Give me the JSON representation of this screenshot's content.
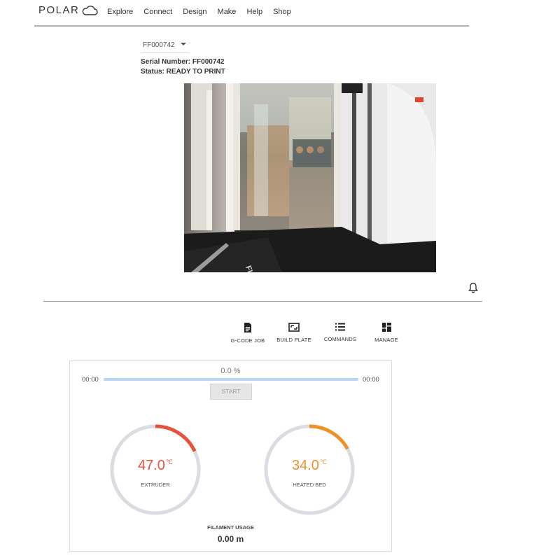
{
  "header": {
    "logo_text": "POLAR",
    "nav": [
      "Explore",
      "Connect",
      "Design",
      "Make",
      "Help",
      "Shop"
    ]
  },
  "printer": {
    "selected": "FF000742",
    "serial": "Serial Number: FF000742",
    "status": "Status: READY TO PRINT"
  },
  "camera": {
    "alt": "printer camera feed"
  },
  "toolbar": [
    {
      "label": "G-CODE JOB",
      "icon": "document-icon"
    },
    {
      "label": "BUILD PLATE",
      "icon": "build-plate-icon"
    },
    {
      "label": "COMMANDS",
      "icon": "list-icon"
    },
    {
      "label": "MANAGE",
      "icon": "dashboard-icon"
    }
  ],
  "job": {
    "progress_text": "0.0 %",
    "progress": 0.0,
    "elapsed": "00:00",
    "remaining": "00:00",
    "start_label": "START"
  },
  "gauges": {
    "extruder": {
      "value": "47.0",
      "unit": "℃",
      "label": "EXTRUDER",
      "fraction": 0.18,
      "color": "#e8513b"
    },
    "bed": {
      "value": "34.0",
      "unit": "℃",
      "label": "HEATED BED",
      "fraction": 0.17,
      "color": "#f0902a"
    }
  },
  "filament": {
    "title": "FILAMENT USAGE",
    "value": "0.00 m"
  },
  "colors": {
    "gauge_track": "#d9dde2",
    "accent_blue": "#b9d6ee"
  }
}
